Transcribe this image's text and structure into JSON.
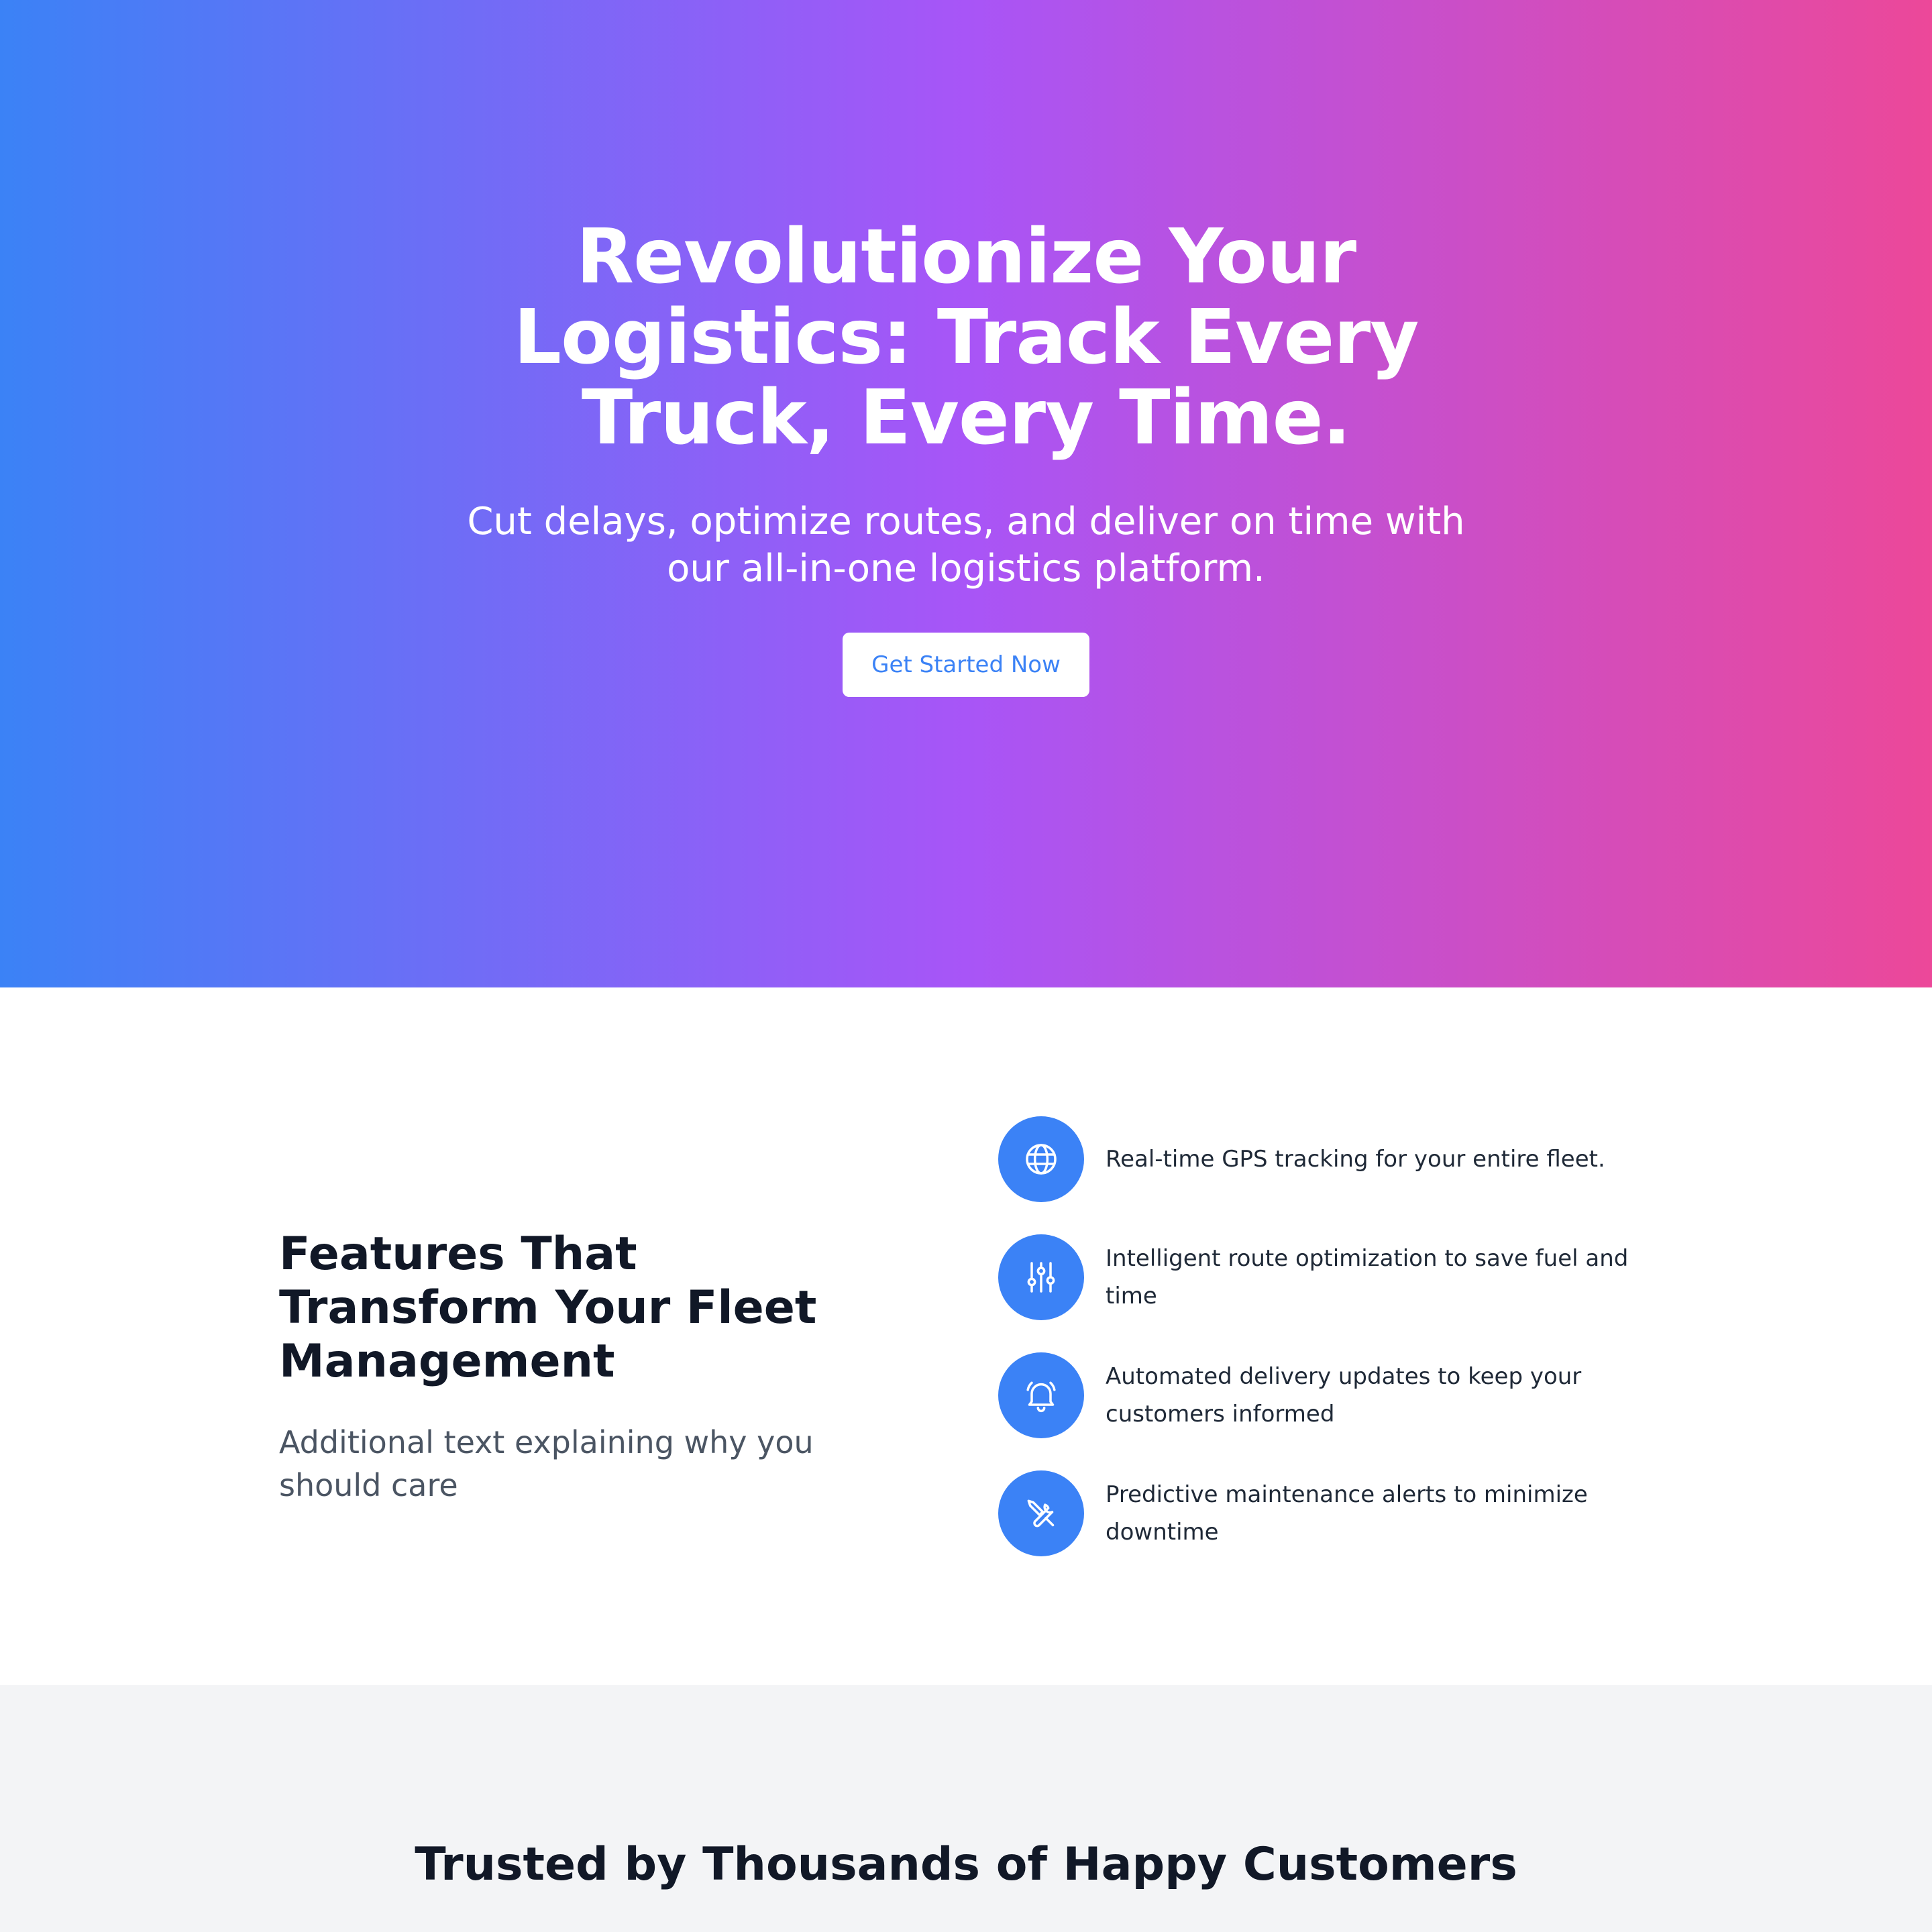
{
  "hero": {
    "title": "Revolutionize Your Logistics: Track Every Truck, Every Time.",
    "subtitle": "Cut delays, optimize routes, and deliver on time with our all-in-one logistics platform.",
    "cta_label": "Get Started Now",
    "gradient_colors": [
      "#3b82f6",
      "#a855f7",
      "#ec4899"
    ]
  },
  "features": {
    "title": "Features That Transform Your Fleet Management",
    "description": "Additional text explaining why you should care",
    "accent_color": "#3b82f6",
    "items": [
      {
        "icon": "globe-icon",
        "text": "Real-time GPS tracking for your entire fleet."
      },
      {
        "icon": "sliders-icon",
        "text": "Intelligent route optimization to save fuel and time"
      },
      {
        "icon": "bell-icon",
        "text": "Automated delivery updates to keep your customers informed"
      },
      {
        "icon": "wrench-screwdriver-icon",
        "text": "Predictive maintenance alerts to minimize downtime"
      }
    ]
  },
  "testimonials": {
    "title": "Trusted by Thousands of Happy Customers"
  }
}
